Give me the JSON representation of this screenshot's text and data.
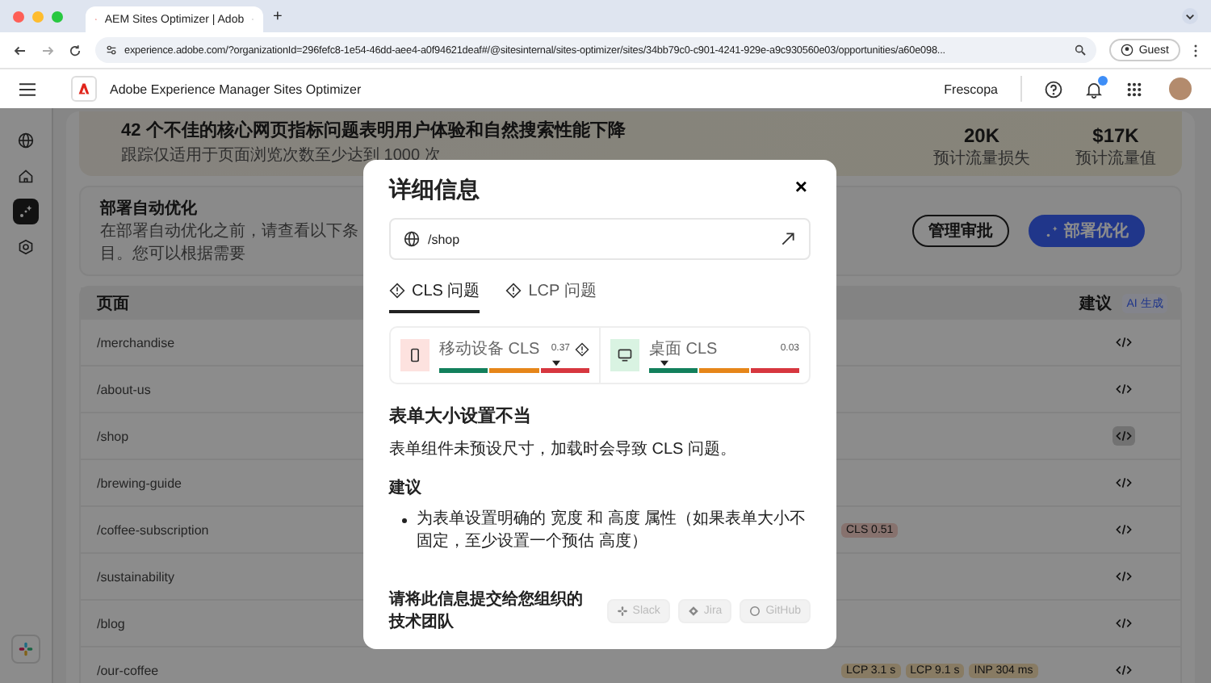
{
  "browser": {
    "tab_title": "AEM Sites Optimizer | Adob",
    "new_tab": "+",
    "url": "experience.adobe.com/?organizationId=296fefc8-1e54-46dd-aee4-a0f94621deaf#/@sitesinternal/sites-optimizer/sites/34bb79c0-c901-4241-929e-a9c930560e03/opportunities/a60e098...",
    "profile": "Guest"
  },
  "header": {
    "product": "Adobe Experience Manager Sites Optimizer",
    "org": "Frescopa",
    "notification": true
  },
  "rail": {
    "items": [
      {
        "kind": "globe",
        "selected": false
      },
      {
        "kind": "home",
        "selected": false
      },
      {
        "kind": "opportunities",
        "selected": true
      },
      {
        "kind": "settings",
        "selected": false
      }
    ]
  },
  "banner": {
    "title": "42 个不佳的核心网页指标问题表明用户体验和自然搜索性能下降",
    "subtitle": "跟踪仅适用于页面浏览次数至少达到 1000 次",
    "stats": [
      {
        "value": "20K",
        "label": "预计流量损失"
      },
      {
        "value": "$17K",
        "label": "预计流量值"
      }
    ]
  },
  "deploy_card": {
    "title": "部署自动优化",
    "description": "在部署自动优化之前，请查看以下条目。您可以根据需要",
    "buttons": [
      {
        "label": "管理审批",
        "kind": "secondary"
      },
      {
        "label": "部署优化",
        "kind": "primary"
      }
    ]
  },
  "table": {
    "columns": [
      "页面",
      "建议"
    ],
    "ai_badge": "AI 生成",
    "rows": [
      {
        "page": "/merchandise",
        "selected": false
      },
      {
        "page": "/about-us",
        "selected": false
      },
      {
        "page": "/shop",
        "selected": true
      },
      {
        "page": "/brewing-guide",
        "selected": false
      },
      {
        "page": "/coffee-subscription",
        "selected": false,
        "badges": [
          {
            "text": "CLS 0.51",
            "kind": "poor"
          }
        ]
      },
      {
        "page": "/sustainability",
        "selected": false
      },
      {
        "page": "/blog",
        "selected": false
      },
      {
        "page": "/our-coffee",
        "selected": false,
        "badges": [
          {
            "text": "LCP 3.1 s",
            "kind": "warn"
          },
          {
            "text": "LCP 9.1 s",
            "kind": "warn"
          },
          {
            "text": "INP 304 ms",
            "kind": "warn"
          }
        ]
      }
    ]
  },
  "modal": {
    "title": "详细信息",
    "close": "×",
    "url": "/shop",
    "tabs": [
      {
        "label": "CLS 问题",
        "selected": true
      },
      {
        "label": "LCP 问题",
        "selected": false
      }
    ],
    "metrics": [
      {
        "kind": "mobile",
        "label": "移动设备 CLS",
        "reading": "0.37",
        "level": 0.78,
        "warning": true
      },
      {
        "kind": "desktop",
        "label": "桌面 CLS",
        "reading": "0.03",
        "level": 0.1,
        "warning": false
      }
    ],
    "issue_title": "表单大小设置不当",
    "issue_text": "表单组件未预设尺寸，加载时会导致 CLS 问题。",
    "advice_title": "建议",
    "advice": [
      "为表单设置明确的 宽度 和 高度 属性（如果表单大小不固定，至少设置一个预估 高度）"
    ],
    "share_text": "请将此信息提交给您组织的技术团队",
    "share_buttons": [
      {
        "label": "Slack",
        "kind": "slack",
        "disabled": true
      },
      {
        "label": "Jira",
        "kind": "jira",
        "disabled": true
      },
      {
        "label": "GitHub",
        "kind": "github",
        "disabled": true
      }
    ]
  }
}
